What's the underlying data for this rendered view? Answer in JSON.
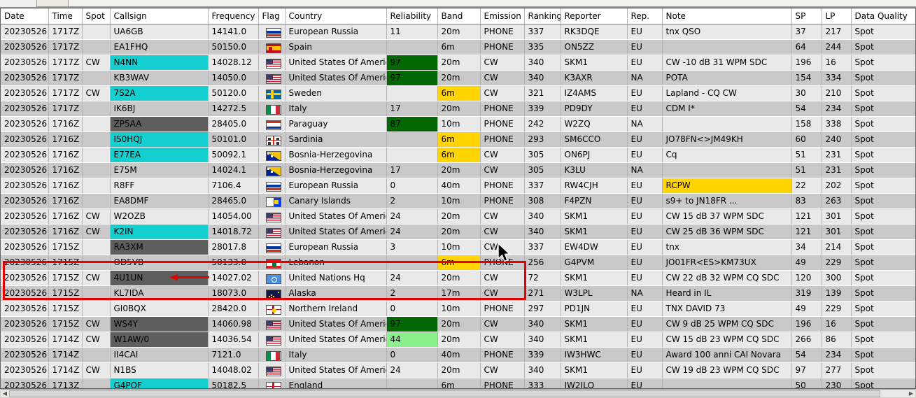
{
  "colors": {
    "accent_cyan": "#14cfd0",
    "accent_dark": "#5e5e5e",
    "accent_green": "#036703",
    "accent_light_green": "#8bf08b",
    "accent_yellow": "#ffd400",
    "annotation_red": "#e20000",
    "time_red": "#e01b1b",
    "row_light": "#e9e9e9",
    "row_dark": "#c9c9c9"
  },
  "grid": {
    "columns": [
      {
        "key": "date",
        "label": "Date"
      },
      {
        "key": "time",
        "label": "Time"
      },
      {
        "key": "spot",
        "label": "Spot"
      },
      {
        "key": "callsign",
        "label": "Callsign"
      },
      {
        "key": "frequency",
        "label": "Frequency"
      },
      {
        "key": "flag",
        "label": "Flag"
      },
      {
        "key": "country",
        "label": "Country"
      },
      {
        "key": "reliability",
        "label": "Reliability"
      },
      {
        "key": "band",
        "label": "Band"
      },
      {
        "key": "emission",
        "label": "Emission"
      },
      {
        "key": "ranking",
        "label": "Ranking"
      },
      {
        "key": "reporter",
        "label": "Reporter"
      },
      {
        "key": "rep",
        "label": "Rep."
      },
      {
        "key": "note",
        "label": "Note"
      },
      {
        "key": "sp",
        "label": "SP"
      },
      {
        "key": "lp",
        "label": "LP"
      },
      {
        "key": "quality",
        "label": "Data Quality"
      }
    ],
    "rows": [
      {
        "date": "20230526",
        "time": "1717Z",
        "time_red": false,
        "spot": "",
        "callsign": "UA6GB",
        "callsign_style": "",
        "frequency": "14141.0",
        "flag": "ru",
        "country": "European Russia",
        "reliability": "11",
        "reliability_style": "",
        "band": "20m",
        "band_style": "",
        "emission": "PHONE",
        "ranking": "337",
        "reporter": "RK3DQE",
        "rep": "EU",
        "note": "tnx QSO",
        "note_style": "",
        "sp": "37",
        "lp": "217",
        "quality": "Spot"
      },
      {
        "date": "20230526",
        "time": "1717Z",
        "time_red": true,
        "spot": "",
        "callsign": "EA1FHQ",
        "callsign_style": "",
        "frequency": "50150.0",
        "flag": "es",
        "country": "Spain",
        "reliability": "",
        "reliability_style": "",
        "band": "6m",
        "band_style": "",
        "emission": "PHONE",
        "ranking": "335",
        "reporter": "ON5ZZ",
        "rep": "EU",
        "note": "",
        "note_style": "",
        "sp": "64",
        "lp": "244",
        "quality": "Spot"
      },
      {
        "date": "20230526",
        "time": "1717Z",
        "time_red": true,
        "spot": "CW",
        "callsign": "N4NN",
        "callsign_style": "cyan",
        "frequency": "14028.12",
        "flag": "us",
        "country": "United States Of America",
        "reliability": "97",
        "reliability_style": "green",
        "band": "20m",
        "band_style": "",
        "emission": "CW",
        "ranking": "340",
        "reporter": "SKM1",
        "rep": "EU",
        "note": "CW  -10 dB 31 WPM  SDC",
        "note_style": "",
        "sp": "196",
        "lp": "16",
        "quality": "Spot"
      },
      {
        "date": "20230526",
        "time": "1717Z",
        "time_red": true,
        "spot": "",
        "callsign": "KB3WAV",
        "callsign_style": "",
        "frequency": "14050.0",
        "flag": "us",
        "country": "United States Of America",
        "reliability": "97",
        "reliability_style": "green",
        "band": "20m",
        "band_style": "",
        "emission": "CW",
        "ranking": "340",
        "reporter": "K3AXR",
        "rep": "NA",
        "note": "POTA",
        "note_style": "",
        "sp": "154",
        "lp": "334",
        "quality": "Spot"
      },
      {
        "date": "20230526",
        "time": "1717Z",
        "time_red": true,
        "spot": "CW",
        "callsign": "7S2A",
        "callsign_style": "cyan",
        "frequency": "50120.0",
        "flag": "se",
        "country": "Sweden",
        "reliability": "",
        "reliability_style": "",
        "band": "6m",
        "band_style": "yellow",
        "emission": "CW",
        "ranking": "321",
        "reporter": "IZ4AMS",
        "rep": "EU",
        "note": "Lapland - CQ CW",
        "note_style": "",
        "sp": "30",
        "lp": "210",
        "quality": "Spot"
      },
      {
        "date": "20230526",
        "time": "1717Z",
        "time_red": false,
        "spot": "",
        "callsign": "IK6BJ",
        "callsign_style": "",
        "frequency": "14272.5",
        "flag": "it",
        "country": "Italy",
        "reliability": "17",
        "reliability_style": "",
        "band": "20m",
        "band_style": "",
        "emission": "PHONE",
        "ranking": "339",
        "reporter": "PD9DY",
        "rep": "EU",
        "note": "CDM I*",
        "note_style": "",
        "sp": "54",
        "lp": "234",
        "quality": "Spot"
      },
      {
        "date": "20230526",
        "time": "1716Z",
        "time_red": false,
        "spot": "",
        "callsign": "ZP5AA",
        "callsign_style": "dark",
        "frequency": "28405.0",
        "flag": "py",
        "country": "Paraguay",
        "reliability": "87",
        "reliability_style": "green",
        "band": "10m",
        "band_style": "",
        "emission": "PHONE",
        "ranking": "242",
        "reporter": "W2ZQ",
        "rep": "NA",
        "note": "",
        "note_style": "",
        "sp": "158",
        "lp": "338",
        "quality": "Spot"
      },
      {
        "date": "20230526",
        "time": "1716Z",
        "time_red": false,
        "spot": "",
        "callsign": "IS0HQJ",
        "callsign_style": "cyan",
        "frequency": "50101.0",
        "flag": "sardinia",
        "country": "Sardinia",
        "reliability": "",
        "reliability_style": "",
        "band": "6m",
        "band_style": "yellow",
        "emission": "PHONE",
        "ranking": "293",
        "reporter": "SM6CCO",
        "rep": "EU",
        "note": "JO78FN<>JM49KH",
        "note_style": "",
        "sp": "60",
        "lp": "240",
        "quality": "Spot"
      },
      {
        "date": "20230526",
        "time": "1716Z",
        "time_red": true,
        "spot": "",
        "callsign": "E77EA",
        "callsign_style": "cyan",
        "frequency": "50092.1",
        "flag": "ba",
        "country": "Bosnia-Herzegovina",
        "reliability": "",
        "reliability_style": "",
        "band": "6m",
        "band_style": "yellow",
        "emission": "CW",
        "ranking": "305",
        "reporter": "ON6PJ",
        "rep": "EU",
        "note": "Cq",
        "note_style": "",
        "sp": "51",
        "lp": "231",
        "quality": "Spot"
      },
      {
        "date": "20230526",
        "time": "1716Z",
        "time_red": true,
        "spot": "",
        "callsign": "E75M",
        "callsign_style": "",
        "frequency": "14024.1",
        "flag": "ba",
        "country": "Bosnia-Herzegovina",
        "reliability": "17",
        "reliability_style": "",
        "band": "20m",
        "band_style": "",
        "emission": "CW",
        "ranking": "305",
        "reporter": "K3LU",
        "rep": "NA",
        "note": "",
        "note_style": "",
        "sp": "51",
        "lp": "231",
        "quality": "Spot"
      },
      {
        "date": "20230526",
        "time": "1716Z",
        "time_red": false,
        "spot": "",
        "callsign": "R8FF",
        "callsign_style": "",
        "frequency": "7106.4",
        "flag": "ru",
        "country": "European Russia",
        "reliability": "0",
        "reliability_style": "",
        "band": "40m",
        "band_style": "",
        "emission": "PHONE",
        "ranking": "337",
        "reporter": "RW4CJH",
        "rep": "EU",
        "note": "RCPW",
        "note_style": "yellow",
        "sp": "22",
        "lp": "202",
        "quality": "Spot"
      },
      {
        "date": "20230526",
        "time": "1716Z",
        "time_red": true,
        "spot": "",
        "callsign": "EA8DMF",
        "callsign_style": "",
        "frequency": "28465.0",
        "flag": "ic",
        "country": "Canary Islands",
        "reliability": "2",
        "reliability_style": "",
        "band": "10m",
        "band_style": "",
        "emission": "PHONE",
        "ranking": "308",
        "reporter": "F4PZN",
        "rep": "EU",
        "note": "s9+ to JN18FR ...",
        "note_style": "",
        "sp": "83",
        "lp": "263",
        "quality": "Spot"
      },
      {
        "date": "20230526",
        "time": "1716Z",
        "time_red": true,
        "spot": "CW",
        "callsign": "W2OZB",
        "callsign_style": "",
        "frequency": "14054.00",
        "flag": "us",
        "country": "United States Of America",
        "reliability": "24",
        "reliability_style": "",
        "band": "20m",
        "band_style": "",
        "emission": "CW",
        "ranking": "340",
        "reporter": "SKM1",
        "rep": "EU",
        "note": "CW  15 dB 37 WPM  SDC",
        "note_style": "",
        "sp": "121",
        "lp": "301",
        "quality": "Spot"
      },
      {
        "date": "20230526",
        "time": "1716Z",
        "time_red": false,
        "spot": "CW",
        "callsign": "K2IN",
        "callsign_style": "cyan",
        "frequency": "14018.72",
        "flag": "us",
        "country": "United States Of America",
        "reliability": "24",
        "reliability_style": "",
        "band": "20m",
        "band_style": "",
        "emission": "CW",
        "ranking": "340",
        "reporter": "SKM1",
        "rep": "EU",
        "note": "CW  25 dB 36 WPM  SDC",
        "note_style": "",
        "sp": "121",
        "lp": "301",
        "quality": "Spot"
      },
      {
        "date": "20230526",
        "time": "1715Z",
        "time_red": false,
        "spot": "",
        "callsign": "RA3XM",
        "callsign_style": "dark",
        "frequency": "28017.8",
        "flag": "ru",
        "country": "European Russia",
        "reliability": "3",
        "reliability_style": "",
        "band": "10m",
        "band_style": "",
        "emission": "CW",
        "ranking": "337",
        "reporter": "EW4DW",
        "rep": "EU",
        "note": "tnx",
        "note_style": "",
        "sp": "34",
        "lp": "214",
        "quality": "Spot"
      },
      {
        "date": "20230526",
        "time": "1715Z",
        "time_red": false,
        "spot": "",
        "callsign": "OD5VB",
        "callsign_style": "",
        "frequency": "50133.0",
        "flag": "lb",
        "country": "Lebanon",
        "reliability": "",
        "reliability_style": "",
        "band": "6m",
        "band_style": "yellow",
        "emission": "PHONE",
        "ranking": "256",
        "reporter": "G4PVM",
        "rep": "EU",
        "note": "JO01FR<ES>KM73UX",
        "note_style": "",
        "sp": "49",
        "lp": "229",
        "quality": "Spot"
      },
      {
        "date": "20230526",
        "time": "1715Z",
        "time_red": true,
        "spot": "CW",
        "callsign": "4U1UN",
        "callsign_style": "dark",
        "frequency": "14027.02",
        "flag": "un",
        "country": "United Nations Hq",
        "reliability": "24",
        "reliability_style": "",
        "band": "20m",
        "band_style": "",
        "emission": "CW",
        "ranking": "72",
        "reporter": "SKM1",
        "rep": "EU",
        "note": "CW  22 dB 32 WPM  CQ  SDC",
        "note_style": "",
        "sp": "120",
        "lp": "300",
        "quality": "Spot"
      },
      {
        "date": "20230526",
        "time": "1715Z",
        "time_red": false,
        "spot": "",
        "callsign": "KL7IDA",
        "callsign_style": "",
        "frequency": "18073.0",
        "flag": "ak",
        "country": "Alaska",
        "reliability": "2",
        "reliability_style": "",
        "band": "17m",
        "band_style": "",
        "emission": "CW",
        "ranking": "271",
        "reporter": "W3LPL",
        "rep": "NA",
        "note": "Heard in IL",
        "note_style": "",
        "sp": "319",
        "lp": "139",
        "quality": "Spot"
      },
      {
        "date": "20230526",
        "time": "1715Z",
        "time_red": false,
        "spot": "",
        "callsign": "GI0BQX",
        "callsign_style": "",
        "frequency": "28420.0",
        "flag": "ni",
        "country": "Northern Ireland",
        "reliability": "0",
        "reliability_style": "",
        "band": "10m",
        "band_style": "",
        "emission": "PHONE",
        "ranking": "297",
        "reporter": "PD1JN",
        "rep": "EU",
        "note": "TNX DAVID 73",
        "note_style": "",
        "sp": "49",
        "lp": "229",
        "quality": "Spot"
      },
      {
        "date": "20230526",
        "time": "1715Z",
        "time_red": false,
        "spot": "CW",
        "callsign": "WS4Y",
        "callsign_style": "dark",
        "frequency": "14060.98",
        "flag": "us",
        "country": "United States Of America",
        "reliability": "97",
        "reliability_style": "green",
        "band": "20m",
        "band_style": "",
        "emission": "CW",
        "ranking": "340",
        "reporter": "SKM1",
        "rep": "EU",
        "note": "CW  9 dB 25 WPM  CQ  SDC",
        "note_style": "",
        "sp": "196",
        "lp": "16",
        "quality": "Spot"
      },
      {
        "date": "20230526",
        "time": "1714Z",
        "time_red": true,
        "spot": "CW",
        "callsign": "W1AW/0",
        "callsign_style": "dark",
        "frequency": "14036.54",
        "flag": "us",
        "country": "United States Of America",
        "reliability": "44",
        "reliability_style": "lgreen",
        "band": "20m",
        "band_style": "",
        "emission": "CW",
        "ranking": "340",
        "reporter": "SKM1",
        "rep": "EU",
        "note": "CW  15 dB 23 WPM  CQ  SDC",
        "note_style": "",
        "sp": "266",
        "lp": "86",
        "quality": "Spot"
      },
      {
        "date": "20230526",
        "time": "1714Z",
        "time_red": false,
        "spot": "",
        "callsign": "II4CAI",
        "callsign_style": "",
        "frequency": "7121.0",
        "flag": "it",
        "country": "Italy",
        "reliability": "0",
        "reliability_style": "",
        "band": "40m",
        "band_style": "",
        "emission": "PHONE",
        "ranking": "339",
        "reporter": "IW3HWC",
        "rep": "EU",
        "note": "Award 100 anni CAI Novara",
        "note_style": "",
        "sp": "54",
        "lp": "234",
        "quality": "Spot"
      },
      {
        "date": "20230526",
        "time": "1714Z",
        "time_red": true,
        "spot": "CW",
        "callsign": "N1BS",
        "callsign_style": "",
        "frequency": "14048.02",
        "flag": "us",
        "country": "United States Of America",
        "reliability": "24",
        "reliability_style": "",
        "band": "20m",
        "band_style": "",
        "emission": "CW",
        "ranking": "340",
        "reporter": "SKM1",
        "rep": "EU",
        "note": "CW  19 dB 23 WPM  CQ  SDC",
        "note_style": "",
        "sp": "97",
        "lp": "277",
        "quality": "Spot"
      },
      {
        "date": "20230526",
        "time": "1713Z",
        "time_red": false,
        "spot": "",
        "callsign": "G4POF",
        "callsign_style": "cyan",
        "frequency": "50182.5",
        "flag": "gb-eng",
        "country": "England",
        "reliability": "",
        "reliability_style": "",
        "band": "6m",
        "band_style": "",
        "emission": "PHONE",
        "ranking": "333",
        "reporter": "IW2ILQ",
        "rep": "EU",
        "note": "",
        "note_style": "",
        "sp": "50",
        "lp": "230",
        "quality": "Spot"
      }
    ]
  },
  "annotations": {
    "highlight_box_label": "highlighted-rows",
    "arrow_label": "pointer-arrow-to-4U1UN"
  },
  "scrollbar": {
    "left_arrow": "◀",
    "right_arrow": "▶"
  }
}
